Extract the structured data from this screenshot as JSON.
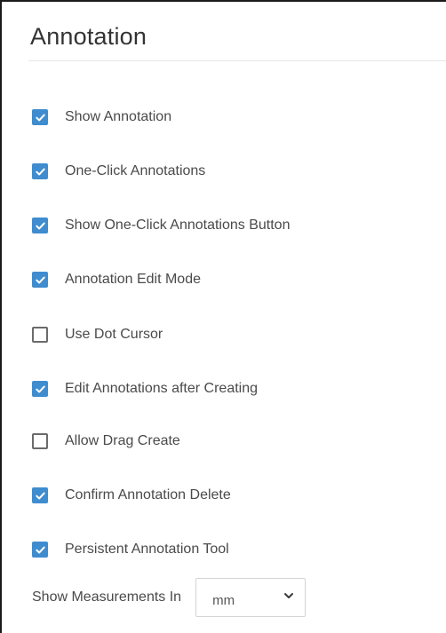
{
  "panel": {
    "title": "Annotation"
  },
  "options": [
    {
      "label": "Show Annotation",
      "checked": true
    },
    {
      "label": "One-Click Annotations",
      "checked": true
    },
    {
      "label": "Show One-Click Annotations Button",
      "checked": true
    },
    {
      "label": "Annotation Edit Mode",
      "checked": true
    },
    {
      "label": "Use Dot Cursor",
      "checked": false
    },
    {
      "label": "Edit Annotations after Creating",
      "checked": true
    },
    {
      "label": "Allow Drag Create",
      "checked": false
    },
    {
      "label": "Confirm Annotation Delete",
      "checked": true
    },
    {
      "label": "Persistent Annotation Tool",
      "checked": true
    }
  ],
  "measurements": {
    "label": "Show Measurements In",
    "selected": "mm"
  },
  "colors": {
    "accent": "#3f8ccf",
    "unchecked_border": "#6b6b6b",
    "text": "#4a4a4a"
  },
  "icons": {
    "check": "checkmark-icon",
    "dropdown": "chevron-down-icon"
  }
}
